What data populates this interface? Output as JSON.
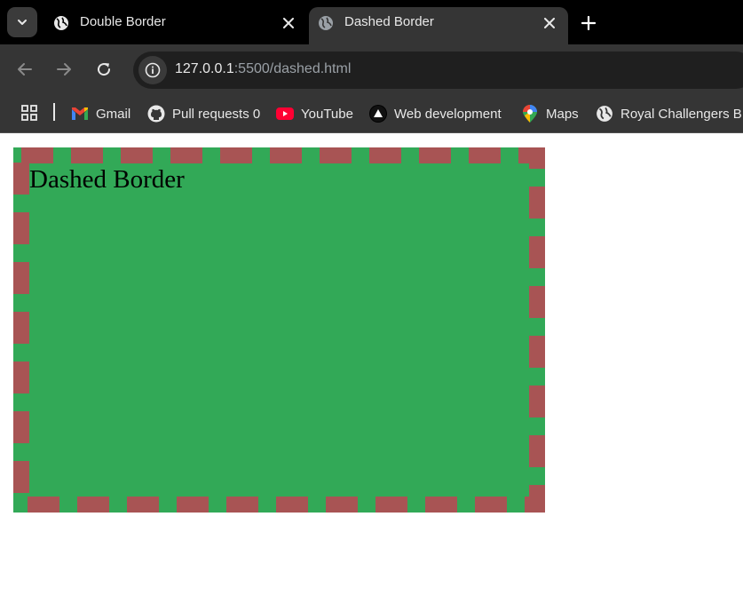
{
  "tabs": [
    {
      "title": "Double Border",
      "active": false
    },
    {
      "title": "Dashed Border",
      "active": true
    }
  ],
  "toolbar": {
    "url_host": "127.0.0.1",
    "url_rest": ":5500/dashed.html"
  },
  "bookmarks": [
    {
      "label": "Gmail",
      "icon": "gmail-icon"
    },
    {
      "label": "Pull requests 0",
      "icon": "github-icon"
    },
    {
      "label": "YouTube",
      "icon": "youtube-icon"
    },
    {
      "label": "Web development",
      "icon": "triangle-icon"
    },
    {
      "label": "Maps",
      "icon": "maps-pin-icon"
    },
    {
      "label": "Royal Challengers B...",
      "icon": "globe-icon"
    }
  ],
  "page": {
    "heading": "Dashed Border"
  },
  "colors": {
    "box_background": "#32a957",
    "dash_color": "#a85454",
    "tab_strip": "#000000",
    "toolbar": "#353535"
  }
}
